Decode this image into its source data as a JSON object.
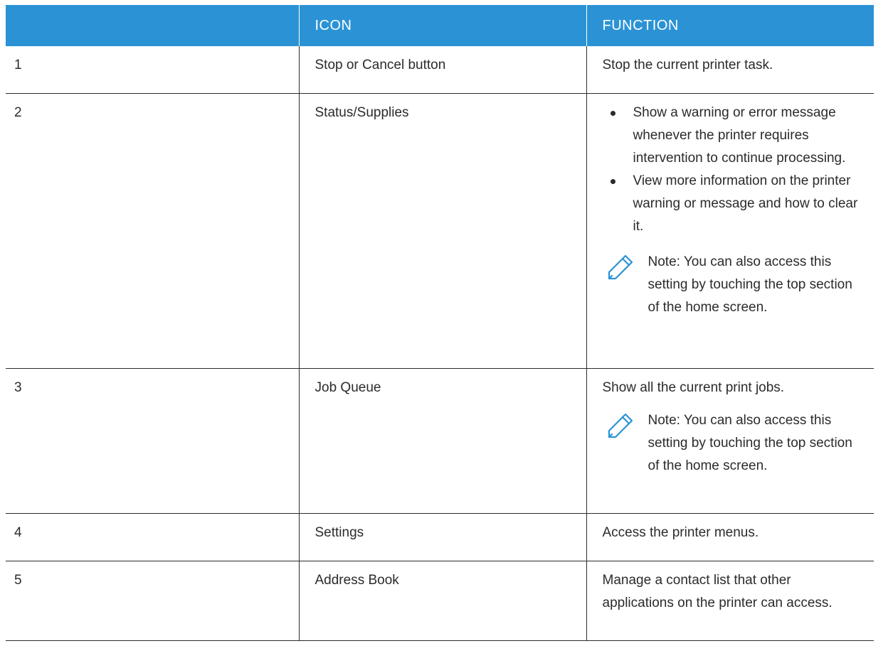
{
  "table": {
    "headers": [
      "",
      "ICON",
      "FUNCTION"
    ],
    "rows": [
      {
        "number": "1",
        "icon": "Stop or Cancel button",
        "function": "Stop the current printer task."
      },
      {
        "number": "2",
        "icon": "Status/Supplies",
        "bullets": [
          "Show a warning or error message whenever the printer requires intervention to continue processing.",
          "View more information on the printer warning or message and how to clear it."
        ],
        "note": "Note: You can also access this setting by touching the top section of the home screen."
      },
      {
        "number": "3",
        "icon": "Job Queue",
        "function": "Show all the current print jobs.",
        "note": "Note: You can also access this setting by touching the top section of the home screen."
      },
      {
        "number": "4",
        "icon": "Settings",
        "function": "Access the printer menus."
      },
      {
        "number": "5",
        "icon": "Address Book",
        "function": "Manage a contact list that other applications on the printer can access."
      }
    ]
  },
  "icons": {
    "note": "pencil-icon"
  },
  "colors": {
    "header_bg": "#2b93d5",
    "header_text": "#ffffff",
    "note_icon": "#2b93d5"
  }
}
